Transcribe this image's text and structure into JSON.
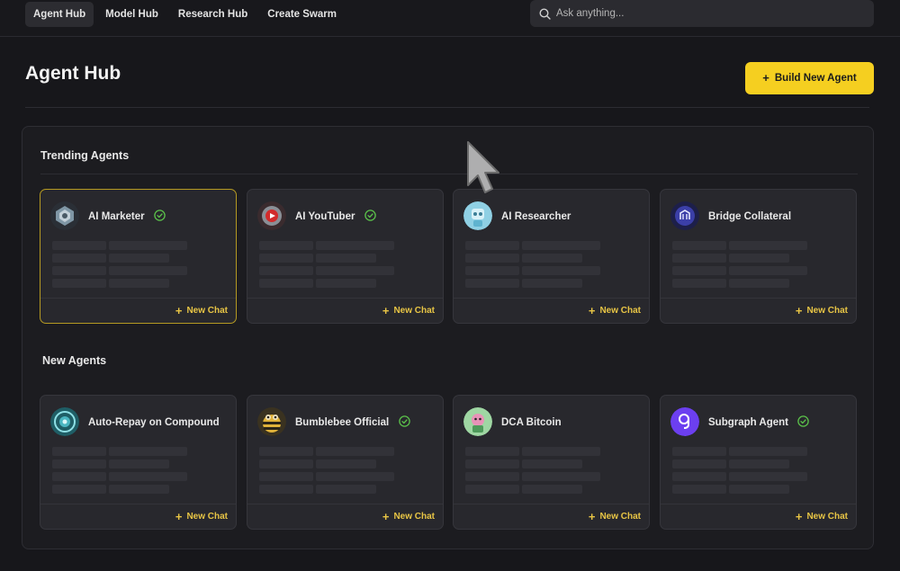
{
  "nav": {
    "tabs": [
      {
        "label": "Agent Hub",
        "active": true
      },
      {
        "label": "Model Hub",
        "active": false
      },
      {
        "label": "Research Hub",
        "active": false
      },
      {
        "label": "Create Swarm",
        "active": false
      }
    ]
  },
  "search": {
    "placeholder": "Ask anything..."
  },
  "page": {
    "title": "Agent Hub",
    "build_label": "Build New Agent"
  },
  "colors": {
    "accent": "#f5cf20",
    "verified": "#5bc24a"
  },
  "trending": {
    "title": "Trending Agents",
    "cards": [
      {
        "name": "AI Marketer",
        "verified": true,
        "icon": "ai-marketer-avatar",
        "new_chat": "New Chat"
      },
      {
        "name": "AI YouTuber",
        "verified": true,
        "icon": "ai-youtuber-avatar",
        "new_chat": "New Chat"
      },
      {
        "name": "AI Researcher",
        "verified": false,
        "icon": "ai-researcher-avatar",
        "new_chat": "New Chat"
      },
      {
        "name": "Bridge Collateral",
        "verified": false,
        "icon": "bridge-collateral-avatar",
        "new_chat": "New Chat"
      }
    ]
  },
  "new_agents": {
    "title": "New Agents",
    "cards": [
      {
        "name": "Auto-Repay on Compound",
        "verified": false,
        "icon": "auto-repay-avatar",
        "new_chat": "New Chat"
      },
      {
        "name": "Bumblebee Official",
        "verified": true,
        "icon": "bumblebee-avatar",
        "new_chat": "New Chat"
      },
      {
        "name": "DCA Bitcoin",
        "verified": false,
        "icon": "dca-bitcoin-avatar",
        "new_chat": "New Chat"
      },
      {
        "name": "Subgraph Agent",
        "verified": true,
        "icon": "subgraph-avatar",
        "new_chat": "New Chat"
      }
    ]
  }
}
